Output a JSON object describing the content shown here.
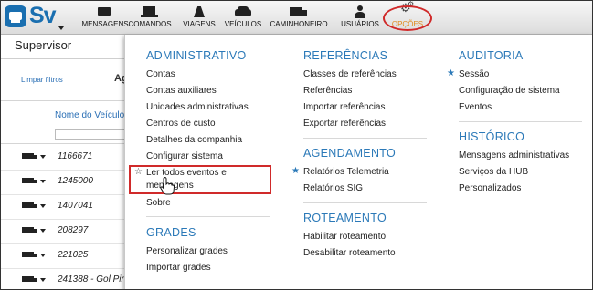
{
  "logo": {
    "brand": "Sv"
  },
  "nav": {
    "items": [
      {
        "label": "MENSAGENS",
        "icon": "mail-icon"
      },
      {
        "label": "COMANDOS",
        "icon": "laptop-icon"
      },
      {
        "label": "VIAGENS",
        "icon": "road-icon"
      },
      {
        "label": "VEÍCULOS",
        "icon": "car-icon"
      },
      {
        "label": "CAMINHONEIRO",
        "icon": "truck-icon"
      },
      {
        "label": "USUÁRIOS",
        "icon": "user-icon"
      },
      {
        "label": "OPÇÕES",
        "icon": "gears-icon"
      }
    ],
    "active_color": "#e08a1c"
  },
  "page": {
    "title": "Supervisor",
    "clear_filters": "Limpar filtros",
    "ag_label": "Ag",
    "column_header": "Nome do Veículo",
    "rows": [
      "1166671",
      "1245000",
      "1407041",
      "208297",
      "221025",
      "241388 - Gol Pir"
    ]
  },
  "menu": {
    "administrativo": {
      "title": "ADMINISTRATIVO",
      "items": [
        "Contas",
        "Contas auxiliares",
        "Unidades administrativas",
        "Centros de custo",
        "Detalhes da companhia",
        "Configurar sistema",
        "Ler todos eventos e",
        "mensagens",
        "Sobre"
      ]
    },
    "grades": {
      "title": "GRADES",
      "items": [
        "Personalizar grades",
        "Importar grades"
      ]
    },
    "referencias": {
      "title": "REFERÊNCIAS",
      "items": [
        "Classes de referências",
        "Referências",
        "Importar referências",
        "Exportar referências"
      ]
    },
    "agendamento": {
      "title": "AGENDAMENTO",
      "items": [
        "Relatórios Telemetria",
        "Relatórios SIG"
      ]
    },
    "roteamento": {
      "title": "ROTEAMENTO",
      "items": [
        "Habilitar roteamento",
        "Desabilitar roteamento"
      ]
    },
    "auditoria": {
      "title": "AUDITORIA",
      "items": [
        "Sessão",
        "Configuração de sistema",
        "Eventos"
      ]
    },
    "historico": {
      "title": "HISTÓRICO",
      "items": [
        "Mensagens administrativas",
        "Serviços da HUB",
        "Personalizados"
      ]
    }
  },
  "colors": {
    "accent": "#2b79b8",
    "highlight": "#d02a2a"
  }
}
